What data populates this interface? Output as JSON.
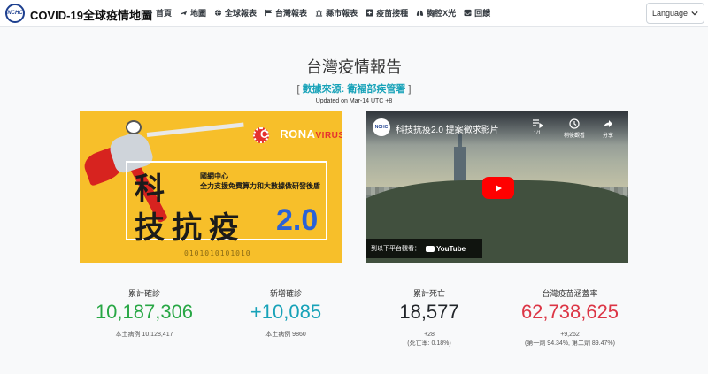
{
  "app": {
    "logo_text": "NCHC",
    "title": "COVID-19全球疫情地圖"
  },
  "nav": {
    "items": [
      {
        "label": "首頁",
        "icon": "arrow-right-icon"
      },
      {
        "label": "地圖",
        "icon": "plane-icon"
      },
      {
        "label": "全球報表",
        "icon": "globe-icon"
      },
      {
        "label": "台灣報表",
        "icon": "flag-icon"
      },
      {
        "label": "縣市報表",
        "icon": "bank-icon"
      },
      {
        "label": "疫苗接種",
        "icon": "plus-square-icon"
      },
      {
        "label": "胸腔X光",
        "icon": "lungs-icon"
      },
      {
        "label": "回饋",
        "icon": "inbox-icon"
      }
    ],
    "language_label": "Language"
  },
  "header": {
    "title": "台灣疫情報告",
    "source_open": "[",
    "source_text": "數據來源: 衛福部疾管署",
    "source_close": "]",
    "updated": "Updated on Mar-14 UTC +8"
  },
  "banner": {
    "corona_prefix": "C",
    "corona_mid": "RONA",
    "corona_suffix": "VIRUS",
    "line1": "科",
    "line2": "技抗疫",
    "version": "2.0",
    "sub1": "國網中心",
    "sub2": "全力支援免費算力和大數據做研發後盾",
    "binary": "0101010101010"
  },
  "video": {
    "logo_text": "NCHC",
    "title": "科技抗疫2.0 提案徵求影片",
    "counter": "1/1",
    "watch_later": "稍後觀看",
    "share": "分享",
    "watch_on": "到以下平台觀看：",
    "youtube": "YouTube"
  },
  "stats": [
    {
      "label": "累計確診",
      "value": "10,187,306",
      "sub": "本土病例 10,128,417",
      "sub2": "",
      "color": "#28a745"
    },
    {
      "label": "新增確診",
      "value": "+10,085",
      "sub": "本土病例 9860",
      "sub2": "",
      "color": "#17a2b8"
    },
    {
      "label": "累計死亡",
      "value": "18,577",
      "sub": "+28",
      "sub2": "(死亡率: 0.18%)",
      "color": "#212529"
    },
    {
      "label": "台灣疫苗涵蓋率",
      "value": "62,738,625",
      "sub": "+9,262",
      "sub2": "(第一劑 94.34%, 第二劑 89.47%)",
      "color": "#dc3545"
    }
  ]
}
